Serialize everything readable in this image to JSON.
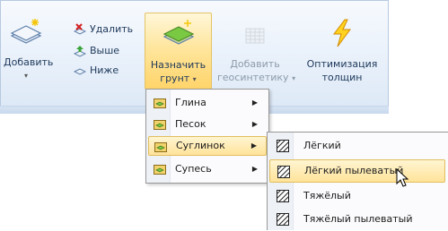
{
  "ribbon": {
    "add_button": {
      "label": "Добавить",
      "icon": "layer-add-icon",
      "caret": "▾"
    },
    "delete_button": {
      "label": "Удалить",
      "icon": "delete-icon"
    },
    "up_button": {
      "label": "Выше",
      "icon": "move-up-icon"
    },
    "down_button": {
      "label": "Ниже",
      "icon": "move-down-icon"
    },
    "assign_soil_button": {
      "label_line1": "Назначить",
      "label_line2": "грунт",
      "caret": "▾",
      "icon": "assign-soil-icon"
    },
    "add_geosynthetic_button": {
      "label_line1": "Добавить",
      "label_line2": "геосинтетику",
      "caret": "▾",
      "icon": "geosynthetic-grid-icon",
      "enabled": false
    },
    "optimize_button": {
      "label_line1": "Оптимизация",
      "label_line2": "толщин",
      "icon": "lightning-icon"
    }
  },
  "soil_menu": {
    "items": [
      {
        "label": "Глина",
        "arrow": "▶"
      },
      {
        "label": "Песок",
        "arrow": "▶"
      },
      {
        "label": "Суглинок",
        "arrow": "▶",
        "highlighted": true
      },
      {
        "label": "Супесь",
        "arrow": "▶"
      }
    ]
  },
  "subtype_menu": {
    "items": [
      {
        "label": "Лёгкий"
      },
      {
        "label": "Лёгкий пылеватый",
        "highlighted": true
      },
      {
        "label": "Тяжёлый"
      },
      {
        "label": "Тяжёлый пылеватый"
      }
    ]
  },
  "colors": {
    "highlight": "#ffe39a",
    "ribbon_bg": "#dce8f6",
    "text": "#1e395b",
    "disabled_text": "#8d9bab"
  }
}
